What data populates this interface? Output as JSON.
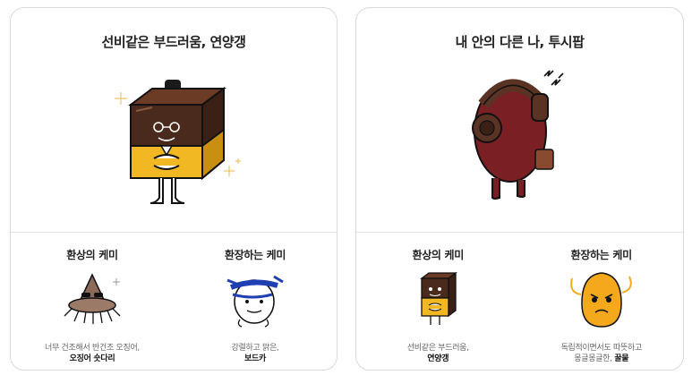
{
  "cards": [
    {
      "title": "선비같은 부드러움, 연양갱",
      "subs": [
        {
          "title": "환상의 케미",
          "desc_line1": "너무 건조해서 반건조 오징어,",
          "desc_bold": "오징어 숏다리"
        },
        {
          "title": "환장하는 케미",
          "desc_line1": "강렬하고 맑은,",
          "desc_bold": "보드카"
        }
      ]
    },
    {
      "title": "내 안의 다른 나, 투시팝",
      "subs": [
        {
          "title": "환상의 케미",
          "desc_line1": "선비같은 부드러움,",
          "desc_bold": "연양갱"
        },
        {
          "title": "환장하는 케미",
          "desc_line1": "독립적이면서도 따뜻하고",
          "desc_line2_prefix": "몽글몽글한, ",
          "desc_bold": "꿀물"
        }
      ]
    }
  ],
  "colors": {
    "yanggaeng_brown": "#4a2a1c",
    "yanggaeng_yellow": "#f2b824",
    "tootsie_red": "#7a1f24",
    "honey_orange": "#f4a81c",
    "vodka_blue": "#1f3fb3"
  }
}
